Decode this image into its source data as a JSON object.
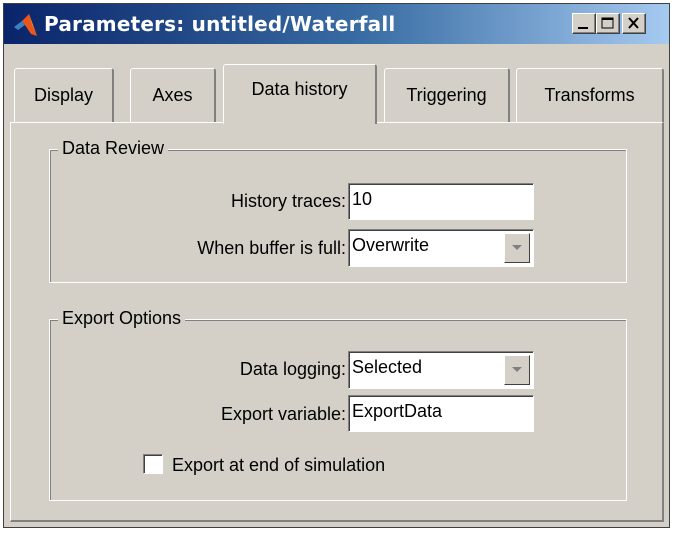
{
  "window": {
    "title": "Parameters: untitled/Waterfall",
    "icon": "matlab-logo-icon",
    "controls": {
      "minimize": "minimize-icon",
      "maximize": "maximize-icon",
      "close": "close-icon"
    }
  },
  "tabs": [
    {
      "label": "Display"
    },
    {
      "label": "Axes"
    },
    {
      "label": "Data history",
      "active": true
    },
    {
      "label": "Triggering"
    },
    {
      "label": "Transforms"
    }
  ],
  "data_review": {
    "legend": "Data Review",
    "history_traces": {
      "label": "History traces:",
      "value": "10"
    },
    "buffer_full": {
      "label": "When buffer is full:",
      "value": "Overwrite"
    }
  },
  "export_options": {
    "legend": "Export Options",
    "data_logging": {
      "label": "Data logging:",
      "value": "Selected"
    },
    "export_variable": {
      "label": "Export variable:",
      "value": "ExportData"
    },
    "export_at_end": {
      "label": "Export at end of simulation",
      "checked": false
    }
  },
  "colors": {
    "titlebar_start": "#0a246a",
    "titlebar_end": "#a6caf0",
    "face": "#d4d0c8"
  }
}
